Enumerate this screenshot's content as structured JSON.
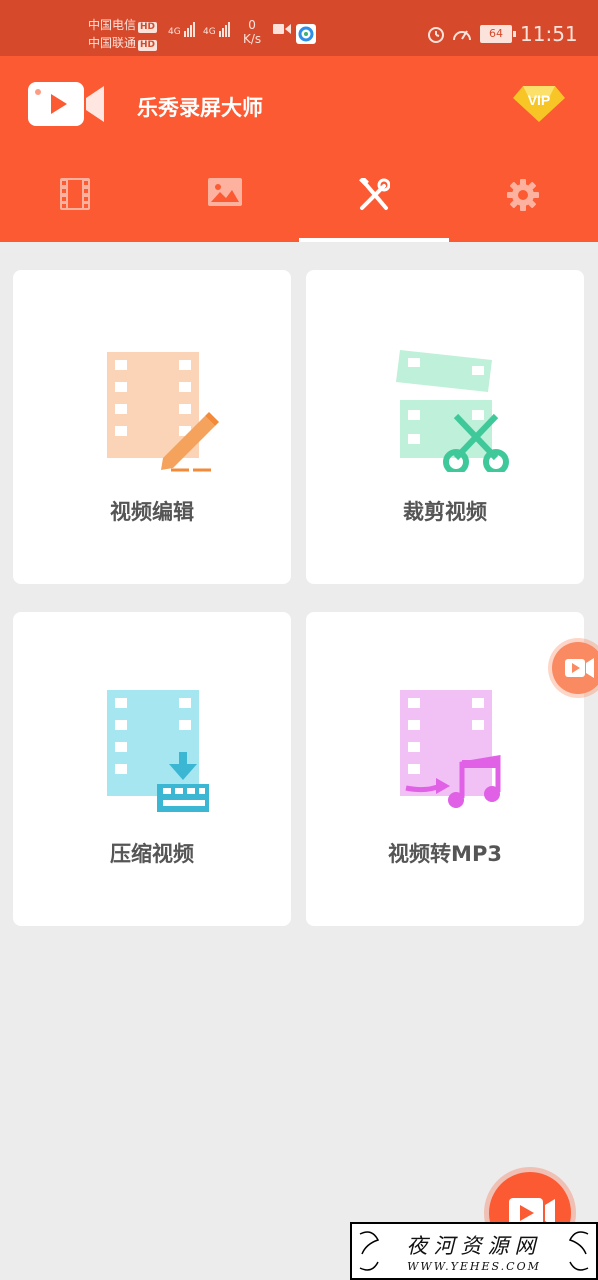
{
  "status_bar": {
    "carrier1": "中国电信",
    "carrier2": "中国联通",
    "hd": "HD",
    "net1": "4G",
    "net2": "4G",
    "speed_value": "0",
    "speed_unit": "K/s",
    "battery": "64",
    "time": "11:51",
    "icons": [
      "video-icon",
      "browser-icon",
      "alarm-icon",
      "speedometer-icon",
      "battery-icon"
    ]
  },
  "app": {
    "title": "乐秀录屏大师",
    "vip_label": "VIP",
    "colors": {
      "header": "#fb5a33",
      "status": "#d6492a",
      "background": "#ececec"
    }
  },
  "tabs": [
    {
      "icon": "film-icon",
      "active": false
    },
    {
      "icon": "image-icon",
      "active": false
    },
    {
      "icon": "tools-icon",
      "active": true
    },
    {
      "icon": "gear-icon",
      "active": false
    }
  ],
  "tools": [
    {
      "label": "视频编辑",
      "icon": "video-edit-icon",
      "color": "#fbd4b8"
    },
    {
      "label": "裁剪视频",
      "icon": "video-cut-icon",
      "color": "#bff0d9"
    },
    {
      "label": "压缩视频",
      "icon": "video-compress-icon",
      "color": "#a5e6f0"
    },
    {
      "label": "视频转MP3",
      "icon": "video-to-mp3-icon",
      "color": "#f1c0f4"
    }
  ],
  "watermark": {
    "text": "夜河资源网",
    "url": "WWW.YEHES.COM"
  }
}
